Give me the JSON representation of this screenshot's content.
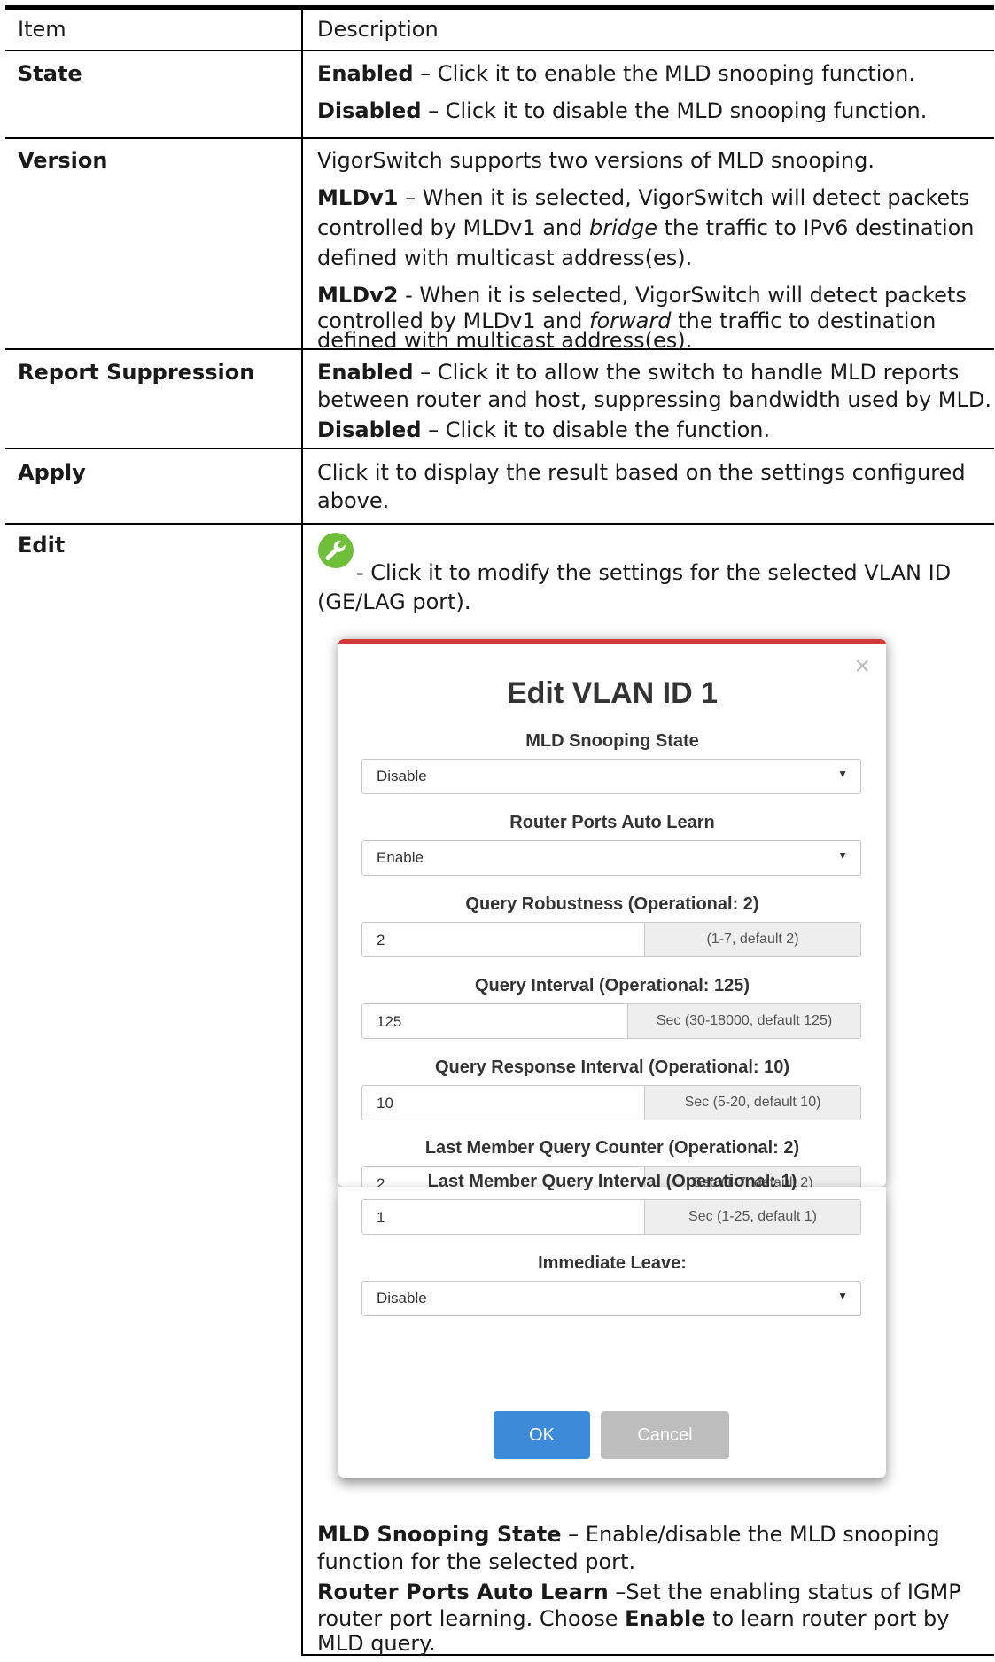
{
  "table": {
    "headers": {
      "item": "Item",
      "description": "Description"
    },
    "rows": {
      "state": {
        "item": "State",
        "line1_term": "Enabled",
        "line1_rest": " – Click it to enable the MLD snooping function.",
        "line2_term": "Disabled",
        "line2_rest": " – Click it to disable the MLD snooping function."
      },
      "version": {
        "item": "Version",
        "intro": "VigorSwitch supports two versions of MLD snooping.",
        "v1_term": "MLDv1",
        "v1_a": " – When it is selected, VigorSwitch will detect packets",
        "v1_b_pre": "controlled by MLDv1 and ",
        "v1_b_em": "bridge",
        "v1_b_post": " the traffic to IPv6 destination",
        "v1_c": "defined with multicast address(es).",
        "v2_term": "MLDv2",
        "v2_a": " - When it is selected, VigorSwitch will detect packets",
        "v2_b_pre": "controlled by MLDv1 and ",
        "v2_b_em": "forward",
        "v2_b_post": " the traffic to destination",
        "v2_c": "defined with multicast address(es)."
      },
      "report": {
        "item": "Report Suppression",
        "e_term": "Enabled",
        "e_a": " – Click it to allow the switch to handle MLD reports",
        "e_b": "between router and host, suppressing bandwidth used by MLD.",
        "d_term": "Disabled",
        "d_rest": " – Click it to disable the function."
      },
      "apply": {
        "item": "Apply",
        "a": "Click it to display the result based on the settings configured",
        "b": "above."
      },
      "edit": {
        "item": "Edit",
        "a": "- Click it to modify the settings for the selected VLAN ID",
        "b": "(GE/LAG port).",
        "mld_term": "MLD Snooping State",
        "mld_a": " – Enable/disable the MLD snooping",
        "mld_b": "function for the selected port.",
        "rp_term": "Router Ports Auto Learn",
        "rp_a": " –Set the enabling status of IGMP",
        "rp_b_pre": "router port learning. Choose ",
        "rp_b_term": "Enable",
        "rp_b_post": " to learn router port by",
        "rp_c": "MLD query."
      }
    }
  },
  "dialog": {
    "title": "Edit VLAN ID 1",
    "close": "×",
    "fields": [
      {
        "label": "MLD Snooping State",
        "value": "Disable"
      },
      {
        "label": "Router Ports Auto Learn",
        "value": "Enable"
      },
      {
        "label": "Query Robustness (Operational: 2)",
        "value": "2",
        "hint": "(1-7, default 2)"
      },
      {
        "label": "Query Interval (Operational: 125)",
        "value": "125",
        "hint": "Sec (30-18000, default 125)"
      },
      {
        "label": "Query Response Interval (Operational: 10)",
        "value": "10",
        "hint": "Sec (5-20, default 10)"
      },
      {
        "label": "Last Member Query Counter (Operational: 2)",
        "value": "2",
        "hint": "Sec (1-7, default 2)"
      },
      {
        "label": "Last Member Query Interval (Operational: 1)",
        "value": "1",
        "hint": "Sec (1-25, default 1)"
      },
      {
        "label": "Immediate Leave:",
        "value": "Disable"
      }
    ],
    "ok_label": "OK",
    "cancel_label": "Cancel"
  },
  "colors": {
    "ok": "#3b8bd8",
    "cancel": "#bdbdbd",
    "wrench": "#6fbf3a",
    "dialog_border": "#d23a3a"
  }
}
